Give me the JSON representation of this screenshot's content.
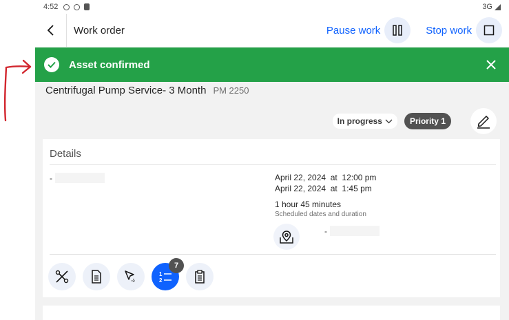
{
  "status_bar": {
    "time": "4:52",
    "network": "3G"
  },
  "header": {
    "title": "Work order",
    "pause_label": "Pause work",
    "stop_label": "Stop work"
  },
  "toast": {
    "message": "Asset confirmed"
  },
  "work_order": {
    "title": "Centrifugal Pump Service- 3 Month",
    "id": "PM 2250",
    "status": "In progress",
    "priority": "Priority 1"
  },
  "details": {
    "heading": "Details",
    "left_value": "-",
    "start": "April 22, 2024  at  12:00 pm",
    "end": "April 22, 2024  at  1:45 pm",
    "duration": "1 hour 45 minutes",
    "duration_caption": "Scheduled dates and duration",
    "location_value": "-"
  },
  "toolbar": {
    "task_count": "7",
    "items": [
      "tools-icon",
      "document-icon",
      "pointer-icon",
      "task-list-icon",
      "clipboard-icon"
    ]
  },
  "colors": {
    "accent": "#0f62fe",
    "success": "#24a148",
    "annotation": "#d2262e"
  }
}
